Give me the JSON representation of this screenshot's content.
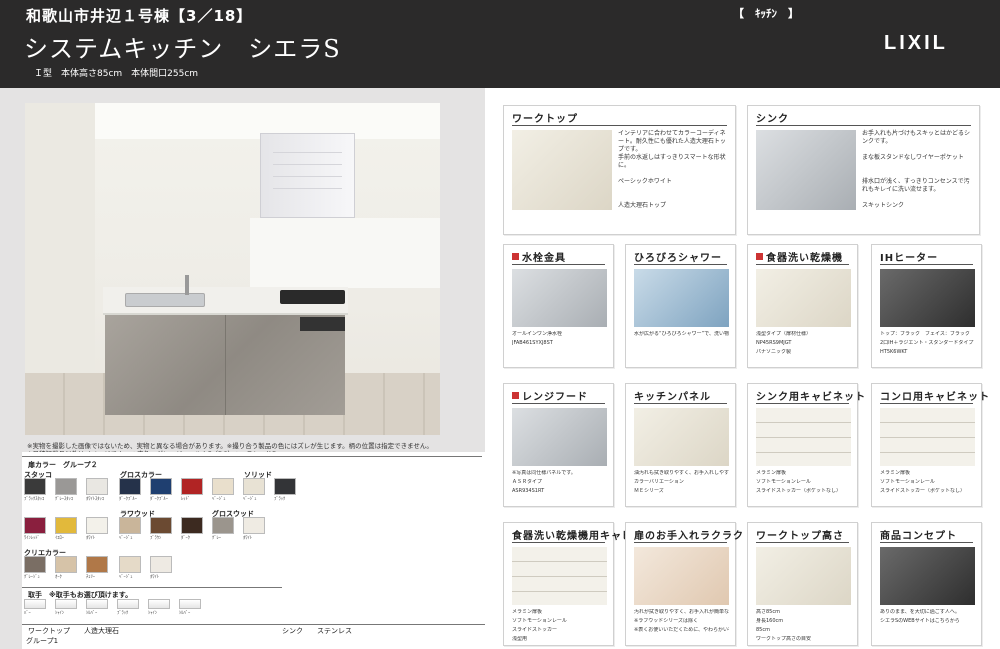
{
  "header": {
    "title": "和歌山市井辺１号棟【3／18】",
    "category": "【　ｷｯﾁﾝ　】",
    "product": "システムキッチン　シエラS",
    "spec": "Ｉ型　本体高さ85cm　本体間口255cm",
    "logo": "LIXIL"
  },
  "notes": [
    "※実物を撮影した画像ではないため、実物と異なる場合があります。※撮り合う製品の色にはズレが生じます。柄の位置は指定できません。",
    "※見積記載品以外はイメージです。 ●床色：グレージュエルムF（DC）●・ラシッサD"
  ],
  "colors": {
    "door_label": "扉カラー　グループ２",
    "groups": [
      {
        "name": "スタッコ",
        "swatches": [
          {
            "label": "ﾌﾞﾗｯｸｽﾀｯｺ",
            "color": "#3a3a3a"
          },
          {
            "label": "ｸﾞﾚｰｽﾀｯｺ",
            "color": "#9a9896"
          },
          {
            "label": "ﾎﾜｲﾄｽﾀｯｺ",
            "color": "#e9e7e2"
          }
        ]
      },
      {
        "name": "グロスカラー",
        "swatches": [
          {
            "label": "ﾀﾞｰｸﾌﾞﾙｰ",
            "color": "#25324a"
          },
          {
            "label": "ﾀﾞｰｸﾌﾞﾙｰ",
            "color": "#1f3f70"
          },
          {
            "label": "ﾚｯﾄﾞ",
            "color": "#b12424"
          },
          {
            "label": "ﾍﾞｰｼﾞｭ",
            "color": "#e9dfcc"
          }
        ]
      },
      {
        "name": "ソリッド",
        "swatches": [
          {
            "label": "ﾍﾞｰｼﾞｭ",
            "color": "#e8e2d4"
          },
          {
            "label": "ﾌﾞﾗｯｸ",
            "color": "#333437"
          }
        ]
      },
      {
        "name": "",
        "swatches": [
          {
            "label": "ﾜｲﾝﾚｯﾄﾞ",
            "color": "#8a1f3e"
          },
          {
            "label": "ｲｴﾛｰ",
            "color": "#e2b93b"
          },
          {
            "label": "ﾎﾜｲﾄ",
            "color": "#f3f1ea"
          }
        ]
      },
      {
        "name": "ラワウッド",
        "swatches": [
          {
            "label": "ﾍﾞｰｼﾞｭ",
            "color": "#c9b59a"
          },
          {
            "label": "ﾌﾞﾗｳﾝ",
            "color": "#6b4a32"
          },
          {
            "label": "ﾀﾞｰｸ",
            "color": "#3c2a20"
          }
        ]
      },
      {
        "name": "グロスウッド",
        "swatches": [
          {
            "label": "ｸﾞﾚｰ",
            "color": "#9b958d"
          },
          {
            "label": "ﾎﾜｲﾄ",
            "color": "#efebe3"
          }
        ]
      },
      {
        "name": "クリエカラー",
        "swatches": [
          {
            "label": "ｸﾞﾚｰｼﾞｭ",
            "color": "#7a6e64"
          },
          {
            "label": "ｵｰｸ",
            "color": "#d6c3a8"
          },
          {
            "label": "ﾁｪﾘｰ",
            "color": "#b07848"
          },
          {
            "label": "ﾍﾞｰｼﾞｭ",
            "color": "#e5dac8"
          },
          {
            "label": "ﾎﾜｲﾄ",
            "color": "#eeeae3"
          }
        ]
      }
    ],
    "handle_label": "取手　※取手もお選び頂けます。",
    "handles": [
      "ﾊﾞｰ",
      "ｼｬｲﾝ",
      "ｼﾙﾊﾞｰ",
      "ﾌﾞﾗｯｸ",
      "ｼｬｲﾝ",
      "ｼﾙﾊﾞｰ"
    ],
    "bottom": [
      {
        "a": "ワークトップ",
        "b": "人造大理石"
      },
      {
        "a": "シンク",
        "b": "ステンレス"
      }
    ],
    "group1": "グループ1"
  },
  "cards": [
    {
      "title": "ワークトップ",
      "texts": [
        "インテリアに合わせてカラーコーディネート。耐久性にも優れた人造大理石トップです。",
        "手前の水返しはすっきりスマートな形状に。",
        "ペーシックホワイト",
        "人造大理石トップ"
      ]
    },
    {
      "title": "シンク",
      "texts": [
        "お手入れも片づけもスキッとはかどるシンクです。",
        "まな板スタンドなしワイヤーポケット",
        "排水口が浅く、すっきりコンセンスで汚れもキレイに洗い流せます。",
        "スキットシンク"
      ]
    },
    {
      "title": "水栓金具",
      "texts": [
        "オールインワン浄水栓",
        "JFAB461SYXJ8ST"
      ]
    },
    {
      "title": "ひろびろシャワー",
      "texts": [
        "水が広がる“ひろびろシャワー”で、洗い物もスピードアップ。"
      ]
    },
    {
      "title": "食器洗い乾燥機",
      "texts": [
        "浅型タイプ（扉材仕様）",
        "NP45RS9MJGT",
        "パナソニック製"
      ]
    },
    {
      "title": "IHヒーター",
      "texts": [
        "トップ：ブラック　フェイス：ブラック",
        "2口IH＋ラジエント・スタンダードタイプ",
        "HT5K6WKT"
      ]
    },
    {
      "title": "レンジフード",
      "texts": [
        "※写真は同仕様パネルです。",
        "ＡＳＲタイプ",
        "ASR934S1RT"
      ]
    },
    {
      "title": "キッチンパネル",
      "texts": [
        "油汚れも拭き取りやすく、お手入れしやすい",
        "カラーバリエーション",
        "ＭＥシリーズ"
      ]
    },
    {
      "title": "シンク用キャビネット",
      "texts": [
        "メラミン扉板",
        "ソフトモーションレール",
        "スライドストッカー（ポケットなし）"
      ]
    },
    {
      "title": "コンロ用キャビネット",
      "texts": [
        "メラミン扉板",
        "ソフトモーションレール",
        "スライドストッカー（ポケットなし）"
      ]
    },
    {
      "title": "食器洗い乾燥機用キャビネット",
      "texts": [
        "メラミン扉板",
        "ソフトモーションレール",
        "スライドストッカー",
        "浅型用"
      ]
    },
    {
      "title": "扉のお手入れラクラク",
      "texts": [
        "汚れが拭き取りやすく、お手入れが簡単な扉です。",
        "※ラフウッドシリーズは除く",
        "※表くお使いいただくために、やわらかい布でお拭きください。"
      ]
    },
    {
      "title": "ワークトップ高さ",
      "texts": [
        "高さ85cm",
        "身長160cm",
        "85cm",
        "ワークトップ高さの目安"
      ]
    },
    {
      "title": "商品コンセプト",
      "texts": [
        "ありのまま、を大切に過ごす人へ。",
        "シエラSのWEBサイトはこちらから"
      ]
    }
  ]
}
